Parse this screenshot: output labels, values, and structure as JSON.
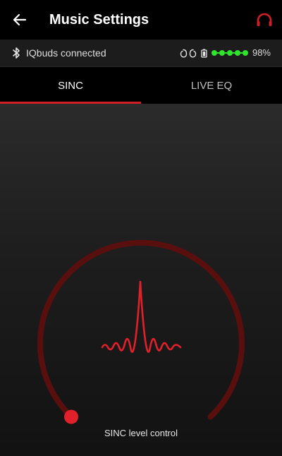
{
  "header": {
    "title": "Music Settings",
    "back_icon": "arrow-left-icon",
    "headphone_icon": "headphones-icon",
    "accent_color": "#d21f26"
  },
  "status": {
    "bluetooth_icon": "bluetooth-icon",
    "text": "IQbuds connected",
    "battery_percent": "98%",
    "battery_level": 0.98,
    "battery_color": "#2ee62e"
  },
  "tabs": [
    {
      "label": "SINC",
      "active": true
    },
    {
      "label": "LIVE EQ",
      "active": false
    }
  ],
  "sinc": {
    "label": "SINC level control",
    "level": 0.0,
    "icon": "sinc-wave-icon",
    "track_color": "#5a0f0f",
    "knob_color": "#e0212b"
  }
}
